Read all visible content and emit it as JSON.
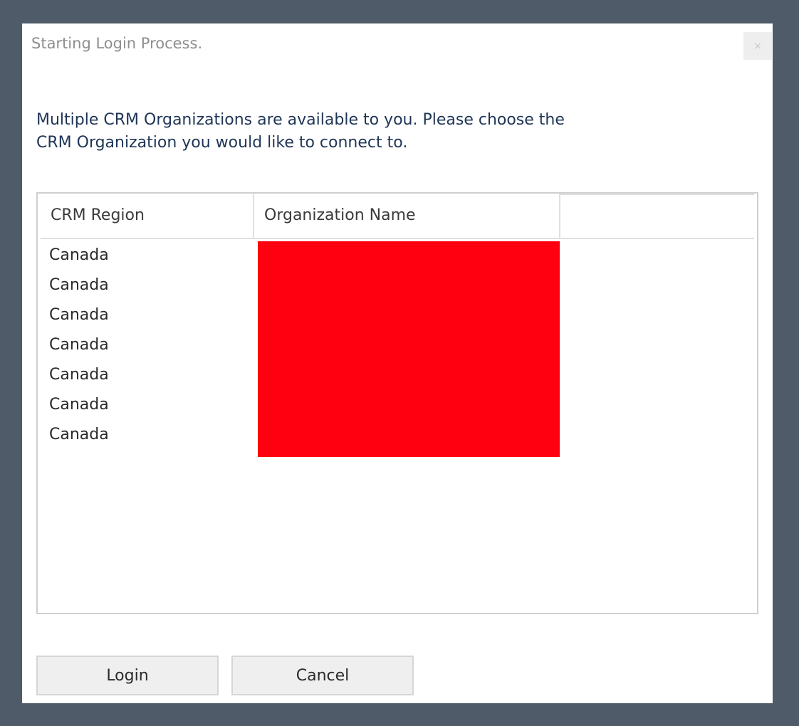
{
  "dialog": {
    "title": "Starting Login Process.",
    "close_label": "×",
    "message": "Multiple CRM Organizations are available to you. Please choose the CRM Organization you would like to connect to."
  },
  "grid": {
    "columns": [
      "CRM Region",
      "Organization Name",
      ""
    ],
    "rows": [
      {
        "region": "Canada"
      },
      {
        "region": "Canada"
      },
      {
        "region": "Canada"
      },
      {
        "region": "Canada"
      },
      {
        "region": "Canada"
      },
      {
        "region": "Canada"
      },
      {
        "region": "Canada"
      }
    ]
  },
  "buttons": {
    "login": "Login",
    "cancel": "Cancel"
  },
  "colors": {
    "backdrop": "#4f5b69",
    "message_text": "#1f3556",
    "redaction": "#ff0010",
    "button_bg": "#efefef"
  }
}
